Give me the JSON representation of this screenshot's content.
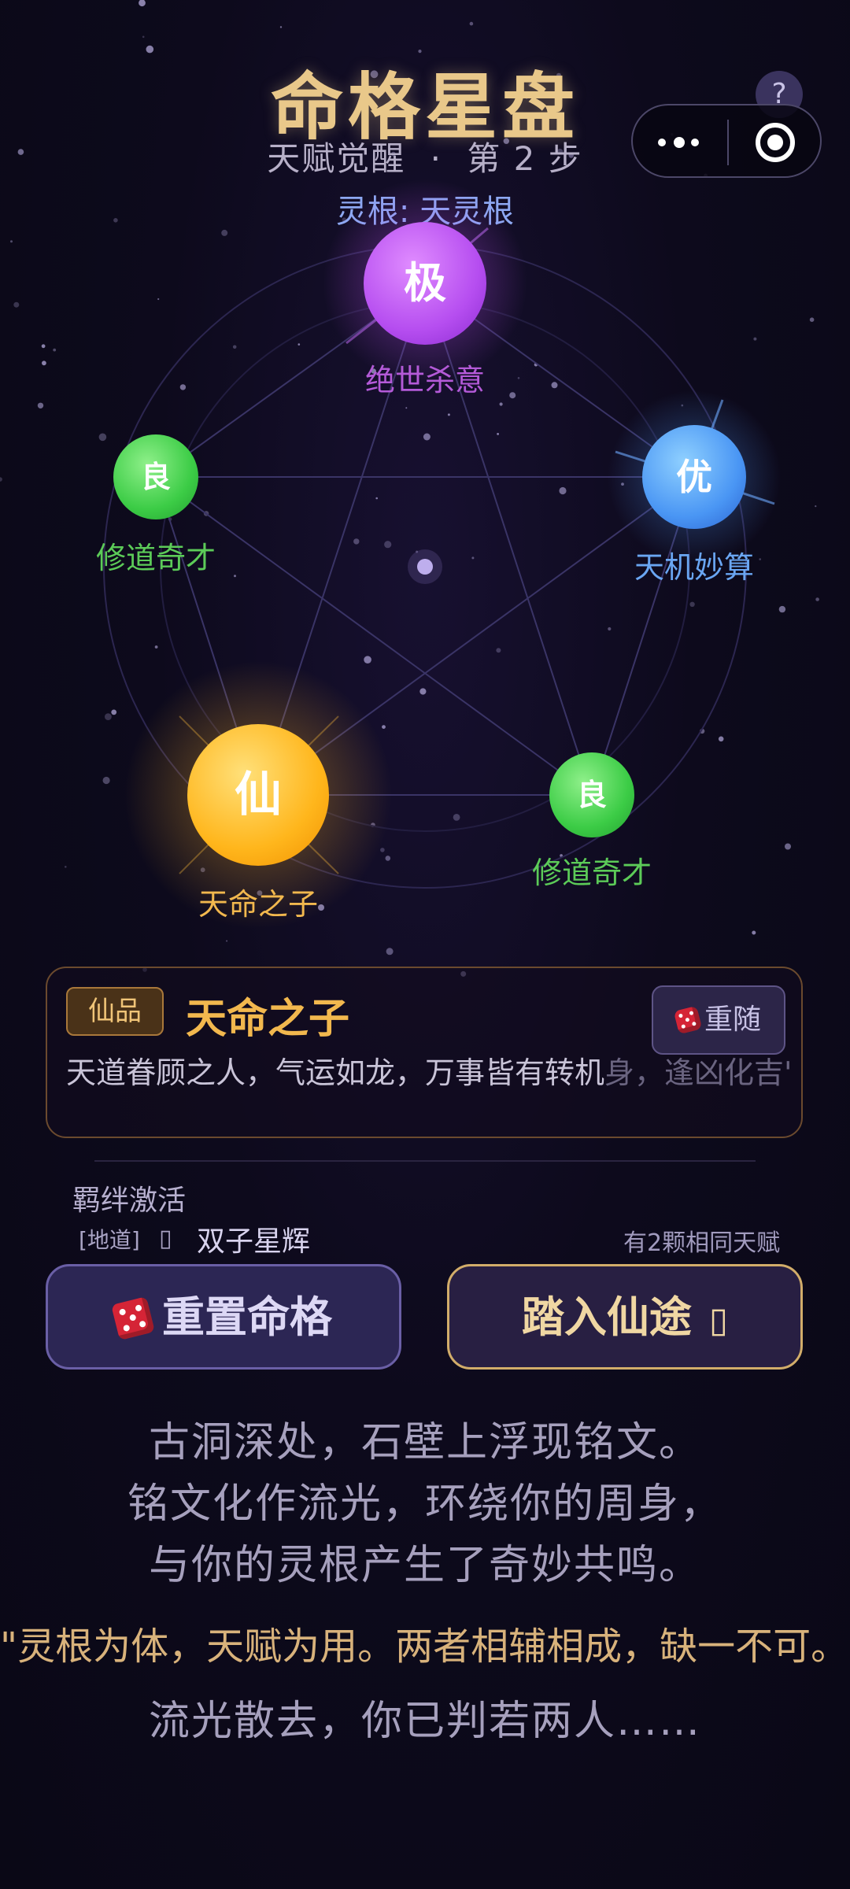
{
  "header": {
    "title": "命格星盘",
    "subtitle_stage": "天赋觉醒",
    "subtitle_dot": "·",
    "subtitle_step": "第 2 步",
    "help_label": "?"
  },
  "capsule": {
    "more_icon": "more-dots-icon",
    "close_icon": "target-circle-icon"
  },
  "spirit_root": "灵根: 天灵根",
  "star_chart": {
    "nodes": [
      {
        "grade": "极",
        "name": "绝世杀意",
        "color": "#c45cf0",
        "label_color": "#b45ad8"
      },
      {
        "grade": "优",
        "name": "天机妙算",
        "color": "#4d9cf5",
        "label_color": "#6aa6f2"
      },
      {
        "grade": "良",
        "name": "修道奇才",
        "color": "#3fcf4d",
        "label_color": "#5ccb58"
      },
      {
        "grade": "仙",
        "name": "天命之子",
        "color": "#ffb81e",
        "label_color": "#f2b84e"
      },
      {
        "grade": "良",
        "name": "修道奇才",
        "color": "#3fcf4d",
        "label_color": "#5ccb58"
      }
    ]
  },
  "talent_card": {
    "badge": "仙品",
    "title": "天命之子",
    "reroll_label": "重随",
    "description": "天道眷顾之人，气运如龙，万事皆有转机",
    "description_ghost": "身，逢凶化吉\""
  },
  "bond": {
    "title": "羁绊激活",
    "tag": "[地道]",
    "icon": "▯",
    "name": "双子星辉",
    "note": "有2颗相同天赋"
  },
  "buttons": {
    "reset_label": "重置命格",
    "enter_label": "踏入仙途",
    "enter_icon": "▯"
  },
  "story": {
    "line1": "古洞深处，石壁上浮现铭文。",
    "line2": "铭文化作流光，环绕你的周身，",
    "line3": "与你的灵根产生了奇妙共鸣。",
    "quote": "\"灵根为体，天赋为用。两者相辅相成，缺一不可。\"",
    "line4": "流光散去，你已判若两人……"
  },
  "colors": {
    "title_gold": "#e9c88a",
    "card_title": "#f2b84e",
    "quote_gold": "#d8b27b"
  }
}
